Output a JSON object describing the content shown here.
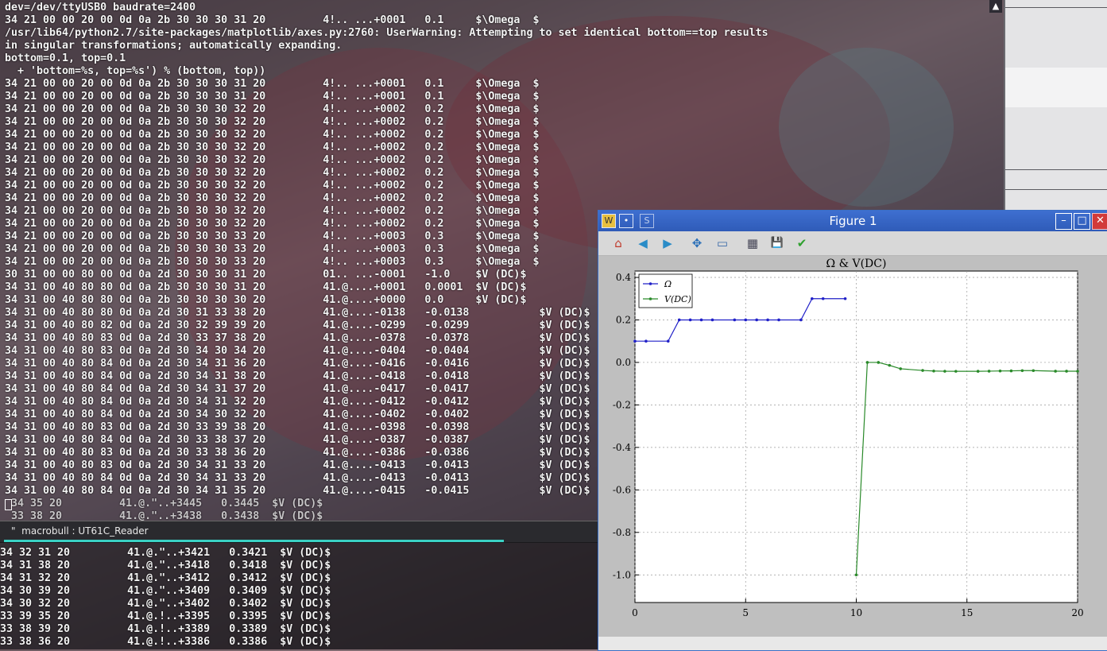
{
  "terminal": {
    "lines": [
      "dev=/dev/ttyUSB0 baudrate=2400",
      "34 21 00 00 20 00 0d 0a 2b 30 30 30 31 20         4!.. ...+0001   0.1     $\\Omega  $",
      "/usr/lib64/python2.7/site-packages/matplotlib/axes.py:2760: UserWarning: Attempting to set identical bottom==top results",
      "in singular transformations; automatically expanding.",
      "bottom=0.1, top=0.1",
      "  + 'bottom=%s, top=%s') % (bottom, top))",
      "34 21 00 00 20 00 0d 0a 2b 30 30 30 31 20         4!.. ...+0001   0.1     $\\Omega  $",
      "34 21 00 00 20 00 0d 0a 2b 30 30 30 31 20         4!.. ...+0001   0.1     $\\Omega  $",
      "34 21 00 00 20 00 0d 0a 2b 30 30 30 32 20         4!.. ...+0002   0.2     $\\Omega  $",
      "34 21 00 00 20 00 0d 0a 2b 30 30 30 32 20         4!.. ...+0002   0.2     $\\Omega  $",
      "34 21 00 00 20 00 0d 0a 2b 30 30 30 32 20         4!.. ...+0002   0.2     $\\Omega  $",
      "34 21 00 00 20 00 0d 0a 2b 30 30 30 32 20         4!.. ...+0002   0.2     $\\Omega  $",
      "34 21 00 00 20 00 0d 0a 2b 30 30 30 32 20         4!.. ...+0002   0.2     $\\Omega  $",
      "34 21 00 00 20 00 0d 0a 2b 30 30 30 32 20         4!.. ...+0002   0.2     $\\Omega  $",
      "34 21 00 00 20 00 0d 0a 2b 30 30 30 32 20         4!.. ...+0002   0.2     $\\Omega  $",
      "34 21 00 00 20 00 0d 0a 2b 30 30 30 32 20         4!.. ...+0002   0.2     $\\Omega  $",
      "34 21 00 00 20 00 0d 0a 2b 30 30 30 32 20         4!.. ...+0002   0.2     $\\Omega  $",
      "34 21 00 00 20 00 0d 0a 2b 30 30 30 32 20         4!.. ...+0002   0.2     $\\Omega  $",
      "34 21 00 00 20 00 0d 0a 2b 30 30 30 33 20         4!.. ...+0003   0.3     $\\Omega  $",
      "34 21 00 00 20 00 0d 0a 2b 30 30 30 33 20         4!.. ...+0003   0.3     $\\Omega  $",
      "34 21 00 00 20 00 0d 0a 2b 30 30 30 33 20         4!.. ...+0003   0.3     $\\Omega  $",
      "30 31 00 00 80 00 0d 0a 2d 30 30 30 31 20         01.. ...-0001   -1.0    $V (DC)$",
      "34 31 00 40 80 80 0d 0a 2b 30 30 30 31 20         41.@....+0001   0.0001  $V (DC)$",
      "34 31 00 40 80 80 0d 0a 2b 30 30 30 30 20         41.@....+0000   0.0     $V (DC)$",
      "34 31 00 40 80 80 0d 0a 2d 30 31 33 38 20         41.@....-0138   -0.0138           $V (DC)$",
      "34 31 00 40 80 82 0d 0a 2d 30 32 39 39 20         41.@....-0299   -0.0299           $V (DC)$",
      "34 31 00 40 80 83 0d 0a 2d 30 33 37 38 20         41.@....-0378   -0.0378           $V (DC)$",
      "34 31 00 40 80 83 0d 0a 2d 30 34 30 34 20         41.@....-0404   -0.0404           $V (DC)$",
      "34 31 00 40 80 84 0d 0a 2d 30 34 31 36 20         41.@....-0416   -0.0416           $V (DC)$",
      "34 31 00 40 80 84 0d 0a 2d 30 34 31 38 20         41.@....-0418   -0.0418           $V (DC)$",
      "34 31 00 40 80 84 0d 0a 2d 30 34 31 37 20         41.@....-0417   -0.0417           $V (DC)$",
      "34 31 00 40 80 84 0d 0a 2d 30 34 31 32 20         41.@....-0412   -0.0412           $V (DC)$",
      "34 31 00 40 80 84 0d 0a 2d 30 34 30 32 20         41.@....-0402   -0.0402           $V (DC)$",
      "34 31 00 40 80 83 0d 0a 2d 30 33 39 38 20         41.@....-0398   -0.0398           $V (DC)$",
      "34 31 00 40 80 84 0d 0a 2d 30 33 38 37 20         41.@....-0387   -0.0387           $V (DC)$",
      "34 31 00 40 80 83 0d 0a 2d 30 33 38 36 20         41.@....-0386   -0.0386           $V (DC)$",
      "34 31 00 40 80 83 0d 0a 2d 30 34 31 33 20         41.@....-0413   -0.0413           $V (DC)$",
      "34 31 00 40 80 84 0d 0a 2d 30 34 31 33 20         41.@....-0413   -0.0413           $V (DC)$",
      "34 31 00 40 80 84 0d 0a 2d 30 34 31 35 20         41.@....-0415   -0.0415           $V (DC)$"
    ],
    "ghost_lines": [
      " 34 35 20         41.@.\"..+3445   0.3445  $V (DC)$",
      " 33 38 20         41.@.\"..+3438   0.3438  $V (DC)$"
    ],
    "scroll_arrow": "▲"
  },
  "tab": {
    "label": "macrobull : UT61C_Reader",
    "prefix": "\""
  },
  "terminal2": {
    "lines": [
      "34 32 31 20         41.@.\"..+3421   0.3421  $V (DC)$",
      "34 31 38 20         41.@.\"..+3418   0.3418  $V (DC)$",
      "34 31 32 20         41.@.\"..+3412   0.3412  $V (DC)$",
      "34 30 39 20         41.@.\"..+3409   0.3409  $V (DC)$",
      "34 30 32 20         41.@.\"..+3402   0.3402  $V (DC)$",
      "33 39 35 20         41.@.!..+3395   0.3395  $V (DC)$",
      "33 38 39 20         41.@.!..+3389   0.3389  $V (DC)$",
      "33 38 36 20         41.@.!..+3386   0.3386  $V (DC)$"
    ]
  },
  "figure": {
    "title": "Figure 1",
    "title_icons": [
      "W",
      "•",
      "S"
    ],
    "window_buttons": {
      "minimize": "–",
      "maximize": "□",
      "close": "✕"
    },
    "tools": [
      {
        "name": "home-icon",
        "glyph": "⌂",
        "color": "#c0392b"
      },
      {
        "name": "back-arrow-icon",
        "glyph": "◀",
        "color": "#2a8cc7"
      },
      {
        "name": "forward-arrow-icon",
        "glyph": "▶",
        "color": "#2a8cc7"
      },
      {
        "name": "pan-icon",
        "glyph": "✥",
        "color": "#2a6fb8"
      },
      {
        "name": "zoom-icon",
        "glyph": "▭",
        "color": "#3a6aa8"
      },
      {
        "name": "subplots-icon",
        "glyph": "▦",
        "color": "#445"
      },
      {
        "name": "save-icon",
        "glyph": "💾",
        "color": "#3a6aa8"
      },
      {
        "name": "edit-check-icon",
        "glyph": "✔",
        "color": "#2ea02e"
      }
    ]
  },
  "chart_data": {
    "type": "line",
    "title": "Ω & V(DC)",
    "xlabel": "",
    "ylabel": "",
    "xlim": [
      0,
      20
    ],
    "ylim": [
      -1.13,
      0.43
    ],
    "xticks": [
      "0",
      "5",
      "10",
      "15",
      "20"
    ],
    "yticks": [
      "0.4",
      "0.2",
      "0.0",
      "-0.2",
      "-0.4",
      "-0.6",
      "-0.8",
      "-1.0"
    ],
    "grid": true,
    "legend_position": "top-left",
    "series": [
      {
        "name": "Ω",
        "color": "#2020c8",
        "x": [
          0,
          0.5,
          1.5,
          2,
          2.5,
          3,
          3.5,
          4.5,
          5,
          5.5,
          6,
          6.5,
          7.5,
          8,
          8.5,
          9.5
        ],
        "y": [
          0.1,
          0.1,
          0.1,
          0.2,
          0.2,
          0.2,
          0.2,
          0.2,
          0.2,
          0.2,
          0.2,
          0.2,
          0.2,
          0.3,
          0.3,
          0.3
        ]
      },
      {
        "name": "V(DC)",
        "color": "#2a8a2a",
        "x": [
          10,
          10.5,
          11,
          11.5,
          12,
          13,
          13.5,
          14,
          14.5,
          15.5,
          16,
          16.5,
          17,
          17.5,
          18,
          19,
          19.5,
          20
        ],
        "y": [
          -1.0,
          0.0001,
          0.0,
          -0.0138,
          -0.0299,
          -0.0378,
          -0.0404,
          -0.0416,
          -0.0418,
          -0.0417,
          -0.0412,
          -0.0402,
          -0.0398,
          -0.0387,
          -0.0386,
          -0.0413,
          -0.0413,
          -0.0415
        ]
      }
    ]
  }
}
